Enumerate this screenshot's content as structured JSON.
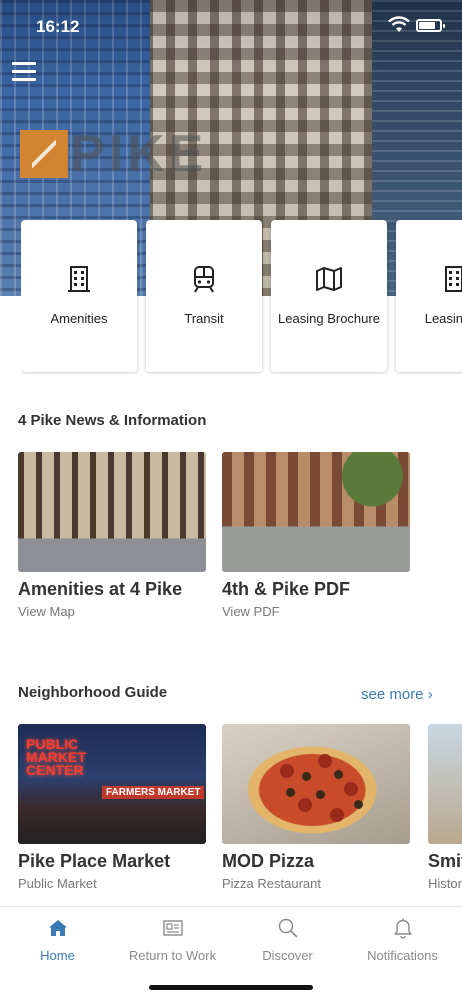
{
  "status": {
    "time": "16:12",
    "battery_level": 0.8
  },
  "hero": {
    "logo_text": "PIKE"
  },
  "quick_links": [
    {
      "label": "Amenities",
      "icon": "building-icon"
    },
    {
      "label": "Transit",
      "icon": "train-icon"
    },
    {
      "label": "Leasing Brochure",
      "icon": "map-icon"
    },
    {
      "label": "Leasing C",
      "icon": "building-icon"
    }
  ],
  "news": {
    "title": "4 Pike News & Information",
    "items": [
      {
        "title": "Amenities at 4 Pike",
        "subtitle": "View Map"
      },
      {
        "title": "4th & Pike PDF",
        "subtitle": "View PDF"
      }
    ]
  },
  "neighborhood": {
    "title": "Neighborhood Guide",
    "see_more": "see more ›",
    "items": [
      {
        "title": "Pike Place Market",
        "subtitle": "Public Market",
        "sign_text": "PUBLIC MARKET CENTER",
        "sign2": "FARMERS MARKET"
      },
      {
        "title": "MOD Pizza",
        "subtitle": "Pizza Restaurant"
      },
      {
        "title": "Smit",
        "subtitle": "Histor"
      }
    ]
  },
  "tabs": [
    {
      "label": "Home",
      "icon": "home-icon",
      "active": true
    },
    {
      "label": "Return to Work",
      "icon": "newspaper-icon",
      "active": false
    },
    {
      "label": "Discover",
      "icon": "search-icon",
      "active": false
    },
    {
      "label": "Notifications",
      "icon": "bell-icon",
      "active": false
    }
  ],
  "colors": {
    "accent": "#3b7bb5",
    "logo": "#d18432",
    "tab_inactive": "#8a8a8a"
  }
}
